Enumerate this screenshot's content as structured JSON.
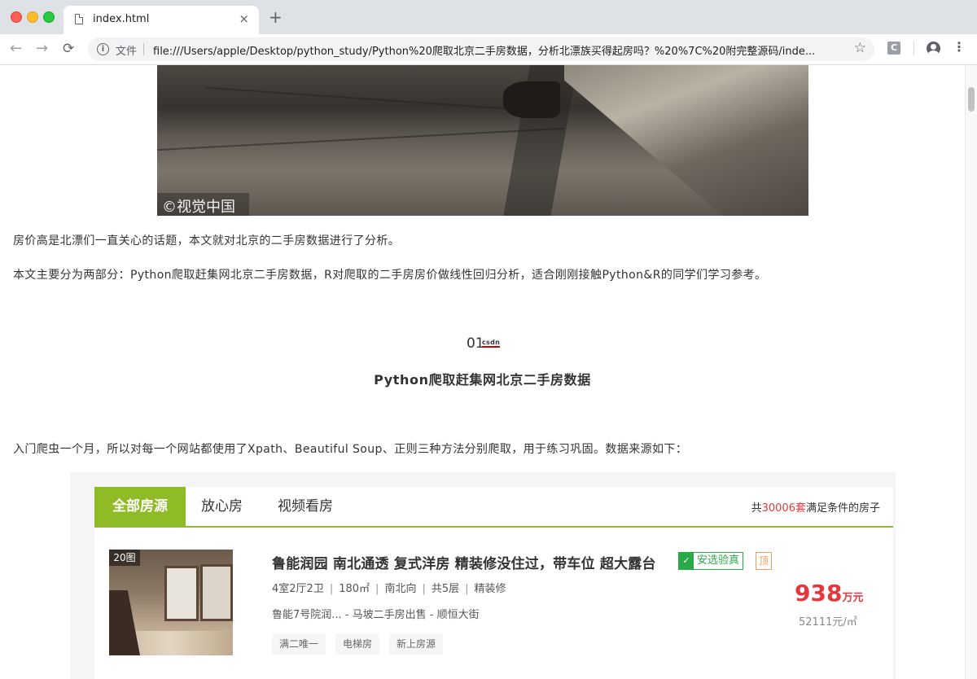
{
  "browser": {
    "tab_title": "index.html",
    "tab_close": "×",
    "new_tab": "+",
    "back": "←",
    "forward": "→",
    "reload": "⟳",
    "info": "i",
    "scheme_label": "文件",
    "url": "file:///Users/apple/Desktop/python_study/Python%20爬取北京二手房数据，分析北漂族买得起房吗？%20%7C%20附完整源码/inde...",
    "star": "☆",
    "extension_label": "C",
    "menu": "⋮"
  },
  "article": {
    "watermark": "©视觉中国",
    "intro": "房价高是北漂们一直关心的话题，本文就对北京的二手房数据进行了分析。",
    "summary": "本文主要分为两部分：Python爬取赶集网北京二手房数据，R对爬取的二手房房价做线性回归分析，适合刚刚接触Python&R的同学们学习参考。",
    "section_number": "01",
    "section_logo": "csdn",
    "section_title": "Python爬取赶集网北京二手房数据",
    "crawler_intro": "入门爬虫一个月，所以对每一个网站都使用了Xpath、Beautiful Soup、正则三种方法分别爬取，用于练习巩固。数据来源如下："
  },
  "listing": {
    "tabs": [
      "全部房源",
      "放心房",
      "视频看房"
    ],
    "total_prefix": "共",
    "total_count": "30006",
    "total_unit": "套",
    "total_suffix": "满足条件的房子",
    "item": {
      "pic_count": "20图",
      "title": "鲁能润园 南北通透 复式洋房 精装修没住过，带车位 超大露台",
      "verified_icon": "✓",
      "verified": "安选验真",
      "top_badge": "顶",
      "layout": "4室2厅2卫",
      "area": "180㎡",
      "orientation": "南北向",
      "floors": "共5层",
      "decoration": "精装修",
      "separator": "|",
      "address": "鲁能7号院润... - 马坡二手房出售 - 顺恒大街",
      "tags": [
        "满二唯一",
        "电梯房",
        "新上房源"
      ],
      "price": "938",
      "price_unit": "万元",
      "unit_price": "52111元/㎡"
    }
  },
  "colors": {
    "accent_green": "#8fbb26",
    "price_red": "#e4393c",
    "verified_green": "#2aa949"
  }
}
